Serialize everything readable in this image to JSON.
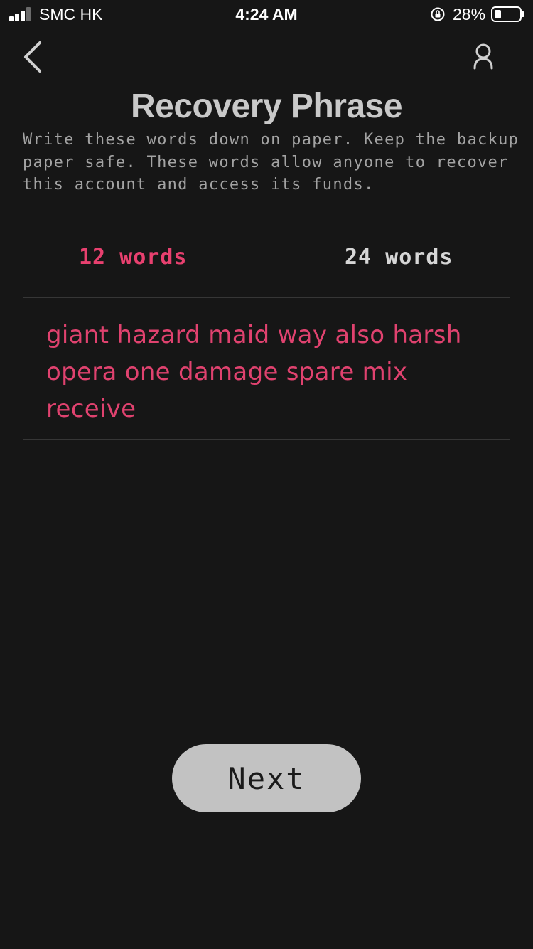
{
  "status_bar": {
    "carrier": "SMC HK",
    "time": "4:24 AM",
    "battery_percent": "28%",
    "battery_level": 0.28,
    "signal_bars": 3
  },
  "nav": {
    "back_icon": "chevron-left-icon",
    "profile_icon": "user-icon"
  },
  "page": {
    "title": "Recovery Phrase",
    "description": "Write these words down on paper. Keep the backup paper safe. These words allow anyone to recover this account and access its funds."
  },
  "tabs": [
    {
      "label": "12 words",
      "active": true
    },
    {
      "label": "24 words",
      "active": false
    }
  ],
  "phrase": {
    "text": "giant hazard maid way also harsh opera one damage spare mix receive"
  },
  "actions": {
    "next_label": "Next"
  },
  "colors": {
    "background": "#161616",
    "accent": "#e8406f",
    "title": "#c9c9c9",
    "button": "#c2c2c2"
  }
}
